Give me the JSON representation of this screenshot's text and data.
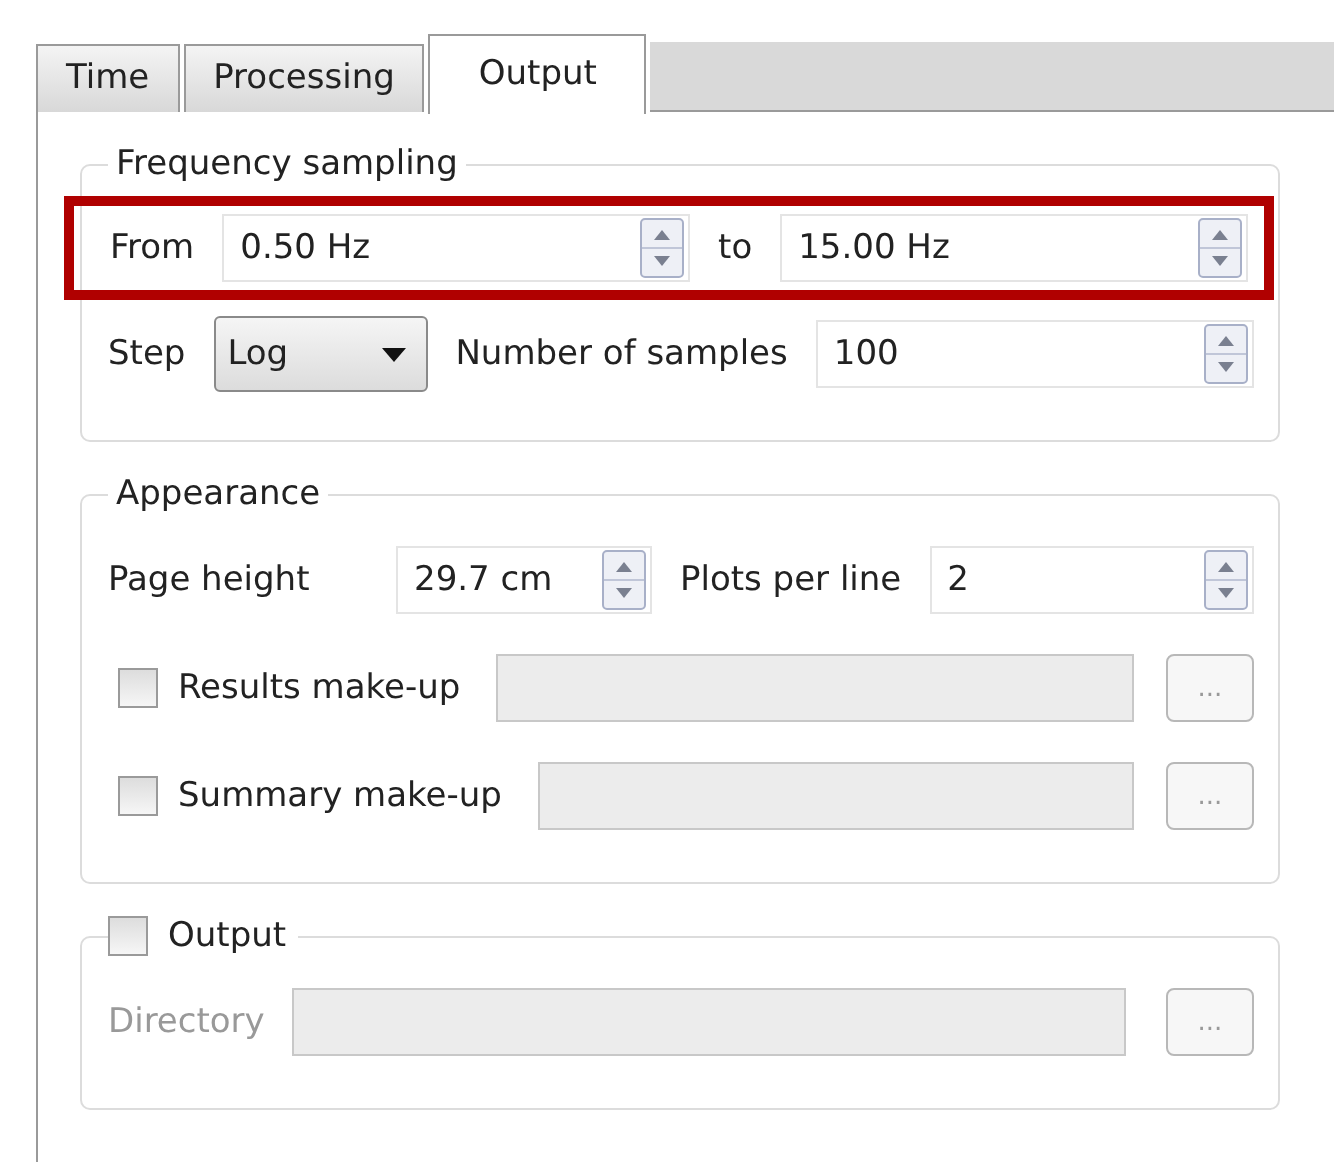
{
  "tabs": [
    {
      "label": "Time",
      "selected": false
    },
    {
      "label": "Processing",
      "selected": false
    },
    {
      "label": "Output",
      "selected": true
    }
  ],
  "frequency_sampling": {
    "title": "Frequency sampling",
    "highlighted": true,
    "from_label": "From",
    "from_value": "0.50 Hz",
    "to_label": "to",
    "to_value": "15.00 Hz",
    "step_label": "Step",
    "step_value": "Log",
    "samples_label": "Number of samples",
    "samples_value": "100"
  },
  "appearance": {
    "title": "Appearance",
    "page_height_label": "Page height",
    "page_height_value": "29.7 cm",
    "plots_label": "Plots per line",
    "plots_value": "2",
    "rows": [
      {
        "label": "Results make-up",
        "checked": false,
        "browse": "..."
      },
      {
        "label": "Summary make-up",
        "checked": false,
        "browse": "..."
      }
    ]
  },
  "output": {
    "label": "Output",
    "checked": false,
    "directory_label": "Directory",
    "browse": "..."
  }
}
